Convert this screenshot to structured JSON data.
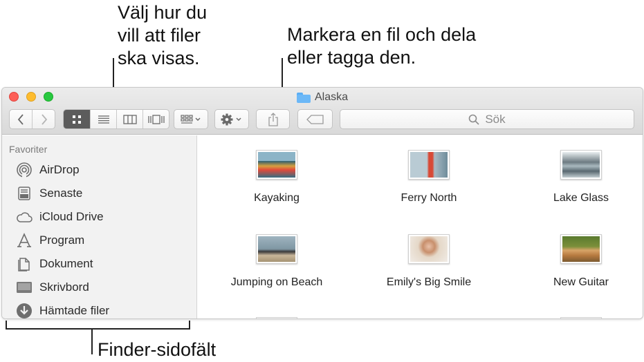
{
  "callouts": {
    "view_options": [
      "Välj hur du",
      "vill att filer",
      "ska visas."
    ],
    "share_tag": [
      "Markera en fil och dela",
      "eller tagga den."
    ],
    "sidebar": "Finder-sidofält"
  },
  "window": {
    "title": "Alaska",
    "title_icon": "folder-icon"
  },
  "toolbar": {
    "search_placeholder": "Sök",
    "buttons": {
      "back": "chevron-left-icon",
      "forward": "chevron-right-icon",
      "view_icon": "icon-view-icon",
      "view_list": "list-view-icon",
      "view_column": "column-view-icon",
      "view_gallery": "gallery-view-icon",
      "group": "group-icon",
      "action": "gear-icon",
      "share": "share-icon",
      "tag": "tag-icon"
    }
  },
  "sidebar": {
    "heading": "Favoriter",
    "items": [
      {
        "label": "AirDrop",
        "icon": "airdrop-icon"
      },
      {
        "label": "Senaste",
        "icon": "recents-icon"
      },
      {
        "label": "iCloud Drive",
        "icon": "cloud-icon"
      },
      {
        "label": "Program",
        "icon": "applications-icon"
      },
      {
        "label": "Dokument",
        "icon": "documents-icon"
      },
      {
        "label": "Skrivbord",
        "icon": "desktop-icon"
      },
      {
        "label": "Hämtade filer",
        "icon": "downloads-icon"
      }
    ]
  },
  "files": [
    {
      "name": "Kayaking"
    },
    {
      "name": "Ferry North"
    },
    {
      "name": "Lake Glass"
    },
    {
      "name": "Jumping on Beach"
    },
    {
      "name": "Emily's Big Smile"
    },
    {
      "name": "New Guitar"
    }
  ],
  "colors": {
    "close": "#fd5f57",
    "minimize": "#febc2e",
    "zoom": "#28c840",
    "folder": "#6cb8f7",
    "selected_segment": "#5c5c5c"
  }
}
